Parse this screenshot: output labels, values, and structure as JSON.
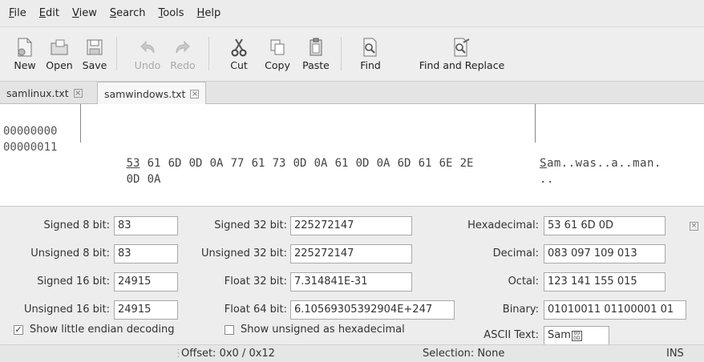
{
  "menu": [
    "File",
    "Edit",
    "View",
    "Search",
    "Tools",
    "Help"
  ],
  "toolbar": {
    "new": "New",
    "open": "Open",
    "save": "Save",
    "undo": "Undo",
    "redo": "Redo",
    "cut": "Cut",
    "copy": "Copy",
    "paste": "Paste",
    "find": "Find",
    "find_replace": "Find and Replace"
  },
  "tabs": [
    {
      "label": "samlinux.txt"
    },
    {
      "label": "samwindows.txt"
    }
  ],
  "hex": {
    "rows": [
      {
        "offset": "00000000",
        "bytes": [
          "53",
          "61",
          "6D",
          "0D",
          "0A",
          "77",
          "61",
          "73",
          "0D",
          "0A",
          "61",
          "0D",
          "0A",
          "6D",
          "61",
          "6E",
          "2E"
        ],
        "ascii_first": "S",
        "ascii_rest": "am..was..a..man."
      },
      {
        "offset": "00000011",
        "bytes": [
          "0D",
          "0A"
        ],
        "ascii_first": "",
        "ascii_rest": ".."
      }
    ]
  },
  "decode": {
    "signed8_label": "Signed 8 bit:",
    "signed8": "83",
    "unsigned8_label": "Unsigned 8 bit:",
    "unsigned8": "83",
    "signed16_label": "Signed 16 bit:",
    "signed16": "24915",
    "unsigned16_label": "Unsigned 16 bit:",
    "unsigned16": "24915",
    "signed32_label": "Signed 32 bit:",
    "signed32": "225272147",
    "unsigned32_label": "Unsigned 32 bit:",
    "unsigned32": "225272147",
    "float32_label": "Float 32 bit:",
    "float32": "7.314841E-31",
    "float64_label": "Float 64 bit:",
    "float64": "6.10569305392904E+247",
    "hex_label": "Hexadecimal:",
    "hex": "53 61 6D 0D",
    "dec_label": "Decimal:",
    "dec": "083 097 109 013",
    "oct_label": "Octal:",
    "oct": "123 141 155 015",
    "bin_label": "Binary:",
    "bin": "01010011 01100001 01",
    "ascii_label": "ASCII Text:",
    "ascii": "Sam",
    "little_endian_label": "Show little endian decoding",
    "little_endian_checked": true,
    "unsigned_hex_label": "Show unsigned as hexadecimal",
    "unsigned_hex_checked": false
  },
  "status": {
    "offset": "Offset: 0x0 / 0x12",
    "selection": "Selection: None",
    "mode": "INS"
  }
}
